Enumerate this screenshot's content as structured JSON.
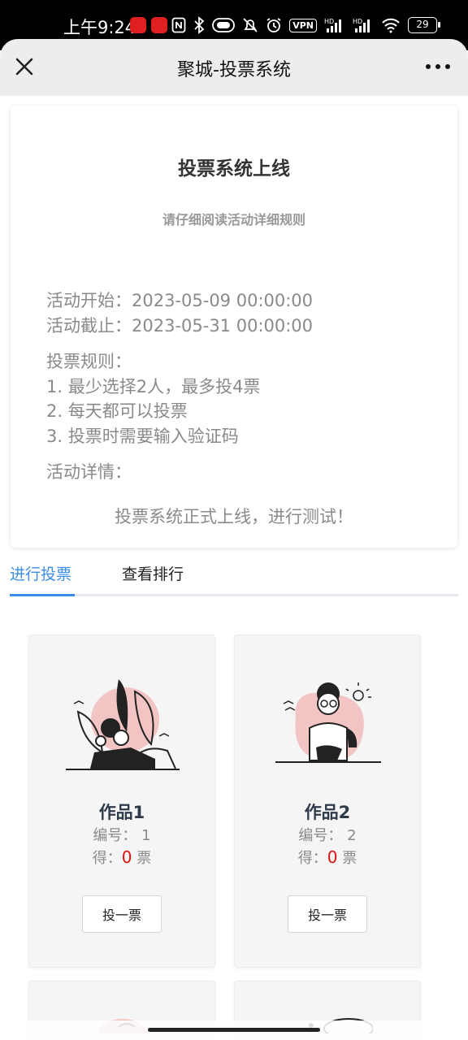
{
  "status_bar": {
    "time": "上午9:24",
    "vpn": "VPN",
    "hd1": "HD",
    "hd2": "HD",
    "battery": "29"
  },
  "header": {
    "title": "聚城-投票系统",
    "close_icon": "close-icon",
    "more_icon": "more-icon"
  },
  "info": {
    "title": "投票系统上线",
    "subtitle": "请仔细阅读活动详细规则",
    "start": "活动开始：2023-05-09 00:00:00",
    "end": "活动截止：2023-05-31 00:00:00",
    "rules_title": "投票规则：",
    "rule1": "1. 最少选择2人，最多投4票",
    "rule2": "2. 每天都可以投票",
    "rule3": "3. 投票时需要输入验证码",
    "details_label": "活动详情：",
    "details_text": "投票系统正式上线，进行测试！"
  },
  "tabs": {
    "vote": "进行投票",
    "ranking": "查看排行"
  },
  "works": [
    {
      "name": "作品1",
      "number_label": "编号：",
      "number": "1",
      "votes_label": "得：",
      "votes": "0",
      "votes_unit": "票",
      "button": "投一票"
    },
    {
      "name": "作品2",
      "number_label": "编号：",
      "number": "2",
      "votes_label": "得：",
      "votes": "0",
      "votes_unit": "票",
      "button": "投一票"
    }
  ],
  "colors": {
    "accent": "#3a8ee6",
    "vote_count": "#e01010",
    "illustration_pink": "#f2c4c4"
  }
}
